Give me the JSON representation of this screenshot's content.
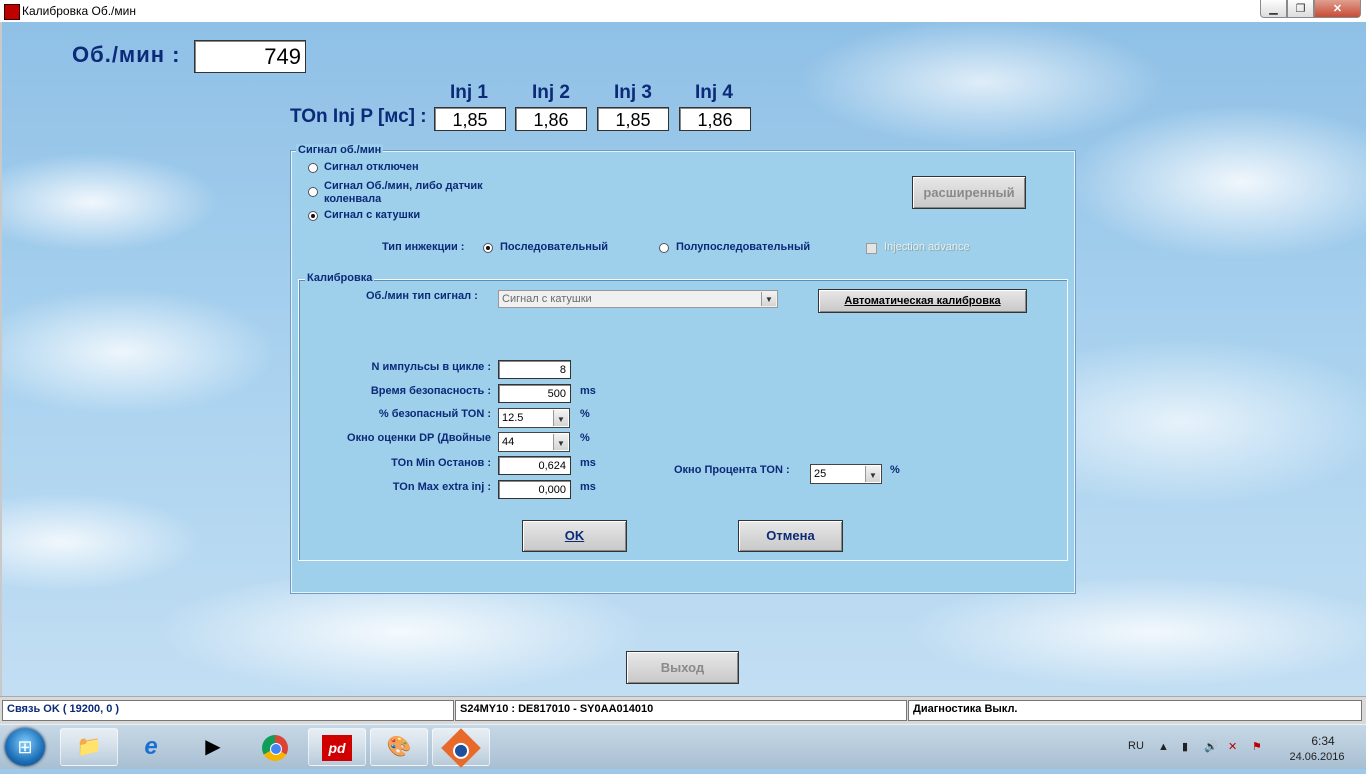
{
  "window": {
    "title": "Калибровка Об./мин",
    "min": "▁",
    "max": "❐",
    "close": "✕"
  },
  "rpm": {
    "label": "Об./мин :",
    "value": "749"
  },
  "ton": {
    "label": "TOn Inj P [мс] :",
    "injectors": [
      {
        "name": "Inj 1",
        "value": "1,85"
      },
      {
        "name": "Inj 2",
        "value": "1,86"
      },
      {
        "name": "Inj 3",
        "value": "1,85"
      },
      {
        "name": "Inj 4",
        "value": "1,86"
      }
    ]
  },
  "signal_group": {
    "legend": "Сигнал об./мин",
    "options": [
      {
        "label": "Сигнал отключен",
        "selected": false
      },
      {
        "label": "Сигнал Об./мин, либо датчик коленвала",
        "selected": false
      },
      {
        "label": "Сигнал с катушки",
        "selected": true
      }
    ],
    "advanced_button": "расширенный",
    "injection_type_label": "Тип инжекции :",
    "injection_options": [
      {
        "label": "Последовательный",
        "selected": true
      },
      {
        "label": "Полупоследовательный",
        "selected": false
      }
    ],
    "injection_advance_label": "Injection advance"
  },
  "calibration_group": {
    "legend": "Калибровка",
    "signal_type_label": "Об./мин тип сигнал :",
    "signal_type_value": "Сигнал с катушки",
    "auto_calibration_button": "Автоматическая калибровка",
    "fields": [
      {
        "label": "N импульсы в цикле :",
        "value": "8",
        "unit": ""
      },
      {
        "label": "Время безопасность :",
        "value": "500",
        "unit": "ms"
      },
      {
        "label": "% безопасный TON :",
        "value": "12.5",
        "unit": "%"
      },
      {
        "label": "Окно оценки DP (Двойные",
        "value": "44",
        "unit": "%"
      },
      {
        "label": "TOn Min Останов :",
        "value": "0,624",
        "unit": "ms"
      },
      {
        "label": "TOn Max extra inj :",
        "value": "0,000",
        "unit": "ms"
      }
    ],
    "ton_window_label": "Окно Процента TON :",
    "ton_window_value": "25",
    "ton_window_unit": "%",
    "ok_button": "OK",
    "cancel_button": "Отмена"
  },
  "exit_button": "Выход",
  "status": {
    "connection": "Связь OK ( 19200,  0 )",
    "ecu": "S24MY10 : DE817010 - SY0AA014010",
    "diagnostics": "Диагностика Выкл."
  },
  "taskbar": {
    "apps": [
      "folder-icon",
      "ie-icon",
      "media-player-icon",
      "chrome-icon",
      "diag-app-icon",
      "paint-icon",
      "eye-app-icon"
    ],
    "lang": "RU",
    "time": "6:34",
    "date": "24.06.2016"
  }
}
